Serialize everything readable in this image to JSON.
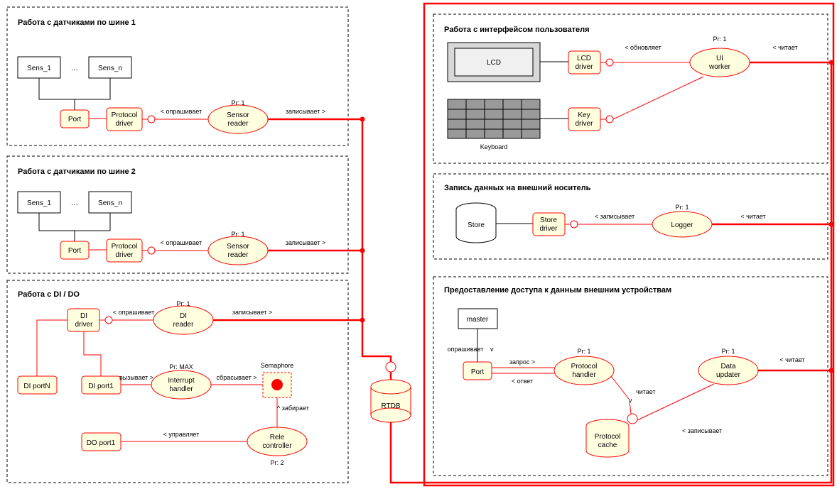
{
  "bus1": {
    "title": "Работа с датчиками по шине 1",
    "sens1": "Sens_1",
    "sensn": "Sens_n",
    "dots": "…",
    "port": "Port",
    "protocol_driver": "Protocol\ndriver",
    "poll": "< опрашивает",
    "pr": "Pr: 1",
    "sensor_reader": "Sensor\nreader",
    "write": "записывает >"
  },
  "bus2": {
    "title": "Работа с датчиками по шине 2",
    "sens1": "Sens_1",
    "sensn": "Sens_n",
    "dots": "…",
    "port": "Port",
    "protocol_driver": "Protocol\ndriver",
    "poll": "< опрашивает",
    "pr": "Pr: 1",
    "sensor_reader": "Sensor\nreader",
    "write": "записывает >"
  },
  "dido": {
    "title": "Работа с DI / DO",
    "di_driver": "DI\ndriver",
    "poll": "< опрашивает",
    "pr1": "Pr: 1",
    "di_reader": "DI\nreader",
    "write": "записывает >",
    "di_portn": "DI portN",
    "di_port1": "DI port1",
    "call": "вызывает >",
    "pr_max": "Pr: MAX",
    "interrupt_handler": "Interrupt\nhandler",
    "reset": "сбрасывает >",
    "semaphore": "Semaphore",
    "take": "^ забирает",
    "do_port1": "DO port1",
    "control": "< управляет",
    "rele_controller": "Rele\ncontroller",
    "pr2": "Pr: 2"
  },
  "rtdb": "RTDB",
  "ui": {
    "title": "Работа с интерфейсом пользователя",
    "lcd": "LCD",
    "lcd_driver": "LCD\ndriver",
    "update": "< обновляет",
    "pr": "Pr: 1",
    "ui_worker": "UI\nworker",
    "read": "< читает",
    "key_driver": "Key\ndriver",
    "keyboard": "Keyboard"
  },
  "store": {
    "title": "Запись данных на внешний носитель",
    "store": "Store",
    "store_driver": "Store\ndriver",
    "write": "< записывает",
    "pr": "Pr: 1",
    "logger": "Logger",
    "read": "< читает"
  },
  "access": {
    "title": "Предоставление доступа к данным внешним устройствам",
    "master": "master",
    "poll": "опрашивает",
    "v1": "v",
    "port": "Port",
    "request": "запрос >",
    "response": "< ответ",
    "pr1": "Pr: 1",
    "protocol_handler": "Protocol\nhandler",
    "reads": "читает",
    "v2": "v",
    "pr2": "Pr: 1",
    "data_updater": "Data\nupdater",
    "read": "< читает",
    "protocol_cache": "Protocol\ncache",
    "writes": "< записывает"
  }
}
